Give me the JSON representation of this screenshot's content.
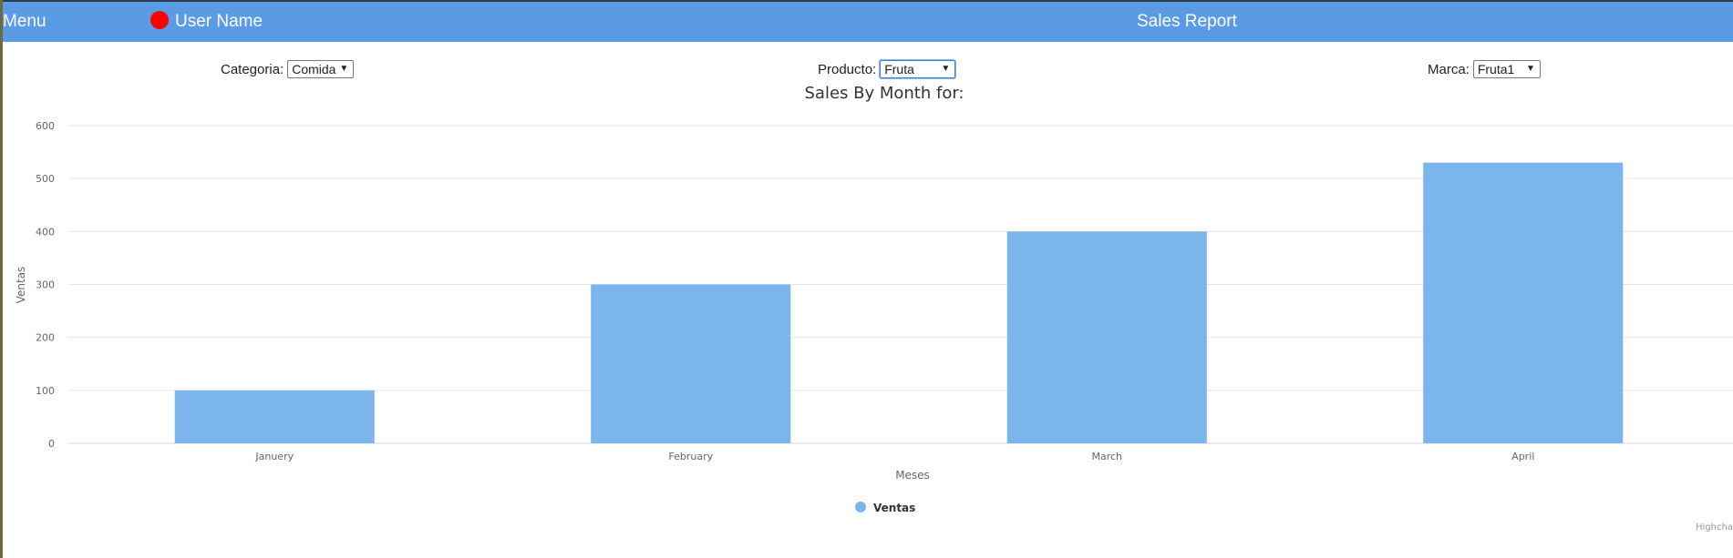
{
  "header": {
    "menu_label": "Menu",
    "user_name": "User Name",
    "report_title": "Sales Report"
  },
  "filters": {
    "categoria": {
      "label": "Categoria:",
      "value": "Comida"
    },
    "producto": {
      "label": "Producto:",
      "value": "Fruta"
    },
    "marca": {
      "label": "Marca:",
      "value": "Fruta1"
    }
  },
  "colors": {
    "header_bg": "#5b9be6",
    "bar": "#7cb5ec",
    "user_dot": "#ff0000"
  },
  "credits": "Highchar",
  "chart_data": {
    "type": "bar",
    "title": "Sales By Month for:",
    "xlabel": "Meses",
    "ylabel": "Ventas",
    "categories": [
      "Januery",
      "February",
      "March",
      "April"
    ],
    "series": [
      {
        "name": "Ventas",
        "values": [
          100,
          300,
          400,
          530
        ]
      }
    ],
    "ylim": [
      0,
      600
    ],
    "yticks": [
      "0",
      "100",
      "200",
      "300",
      "400",
      "500",
      "600"
    ],
    "grid": true,
    "legend": "bottom-center"
  }
}
